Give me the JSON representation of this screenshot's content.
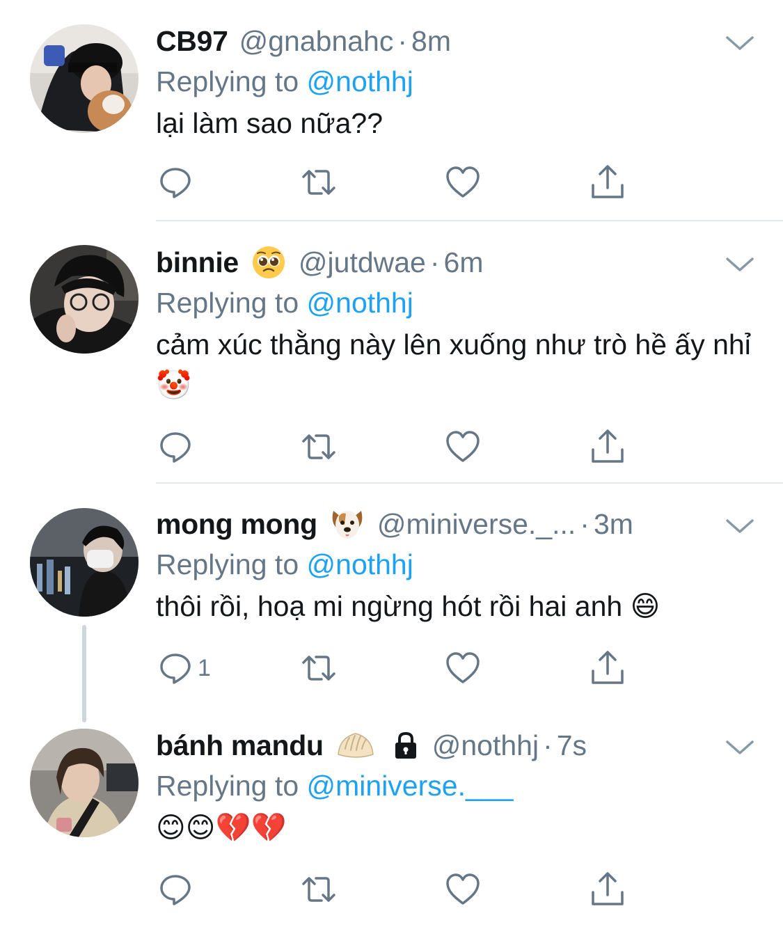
{
  "tweets": [
    {
      "name": "CB97",
      "handle": "@gnabnahc",
      "time": "8m",
      "replying_prefix": "Replying to ",
      "replying_to": "@nothhj",
      "text": "lại làm sao nữa??",
      "emoji": "",
      "reply_count": ""
    },
    {
      "name": "binnie",
      "handle": "@jutdwae",
      "time": "6m",
      "replying_prefix": "Replying to ",
      "replying_to": "@nothhj",
      "text": "cảm xúc thằng này lên xuống như trò hề ấy nhỉ 🤡",
      "emoji": "pleading-face",
      "reply_count": ""
    },
    {
      "name": "mong mong",
      "handle": "@miniverse._...",
      "time": "3m",
      "replying_prefix": "Replying to ",
      "replying_to": "@nothhj",
      "text": "thôi rồi, hoạ mi ngừng hót rồi hai anh 😄",
      "emoji": "dog-face",
      "reply_count": "1"
    },
    {
      "name": "bánh mandu",
      "handle": "@nothhj",
      "time": "7s",
      "replying_prefix": "Replying to ",
      "replying_to": "@miniverse.___",
      "text": "😊😊💔💔",
      "emoji": "dumpling",
      "locked": "lock-icon",
      "reply_count": ""
    }
  ],
  "separator": "·",
  "colors": {
    "name": "#14171a",
    "meta": "#657786",
    "link": "#1da1f2",
    "divider": "#e1e8ed",
    "thread_line": "#ccd6dd"
  },
  "icons": [
    "reply-icon",
    "retweet-icon",
    "like-icon",
    "share-icon",
    "chevron-down-icon",
    "lock-icon"
  ]
}
